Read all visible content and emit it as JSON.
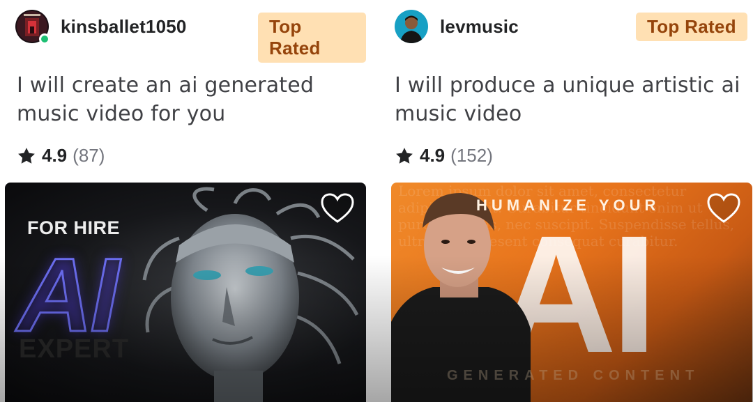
{
  "gigs": [
    {
      "seller": {
        "name": "kinsballet1050",
        "online": true
      },
      "badge": "Top Rated",
      "title": "I will create an ai generated music video for you",
      "rating": {
        "score": "4.9",
        "count": "(87)"
      },
      "thumbnail": {
        "line1": "FOR HIRE",
        "big": "AI",
        "line2": "EXPERT"
      }
    },
    {
      "seller": {
        "name": "levmusic",
        "online": false
      },
      "badge": "Top Rated",
      "title": "I will produce a unique artistic ai music video",
      "rating": {
        "score": "4.9",
        "count": "(152)"
      },
      "thumbnail": {
        "line1": "HUMANIZE YOUR",
        "big": "AI",
        "line2": "GENERATED CONTENT",
        "background_text": "Lorem ipsum dolor sit amet, consectetur adipiscing elit. Curabitur tincidunt enim ut purus egestas, nec suscipit. Suspendisse tellus, ultricies. Praesent consequat curabitur."
      }
    }
  ],
  "colors": {
    "badge_bg": "#ffe0b3",
    "badge_text": "#95440b",
    "online": "#1dbf73",
    "title_text": "#404145",
    "muted": "#74767e"
  },
  "icons": [
    "star-icon",
    "heart-icon",
    "online-status-icon"
  ]
}
